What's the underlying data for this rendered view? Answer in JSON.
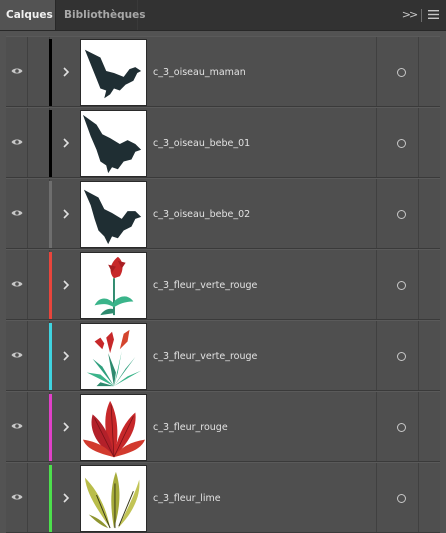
{
  "tabs": {
    "active": "Calques",
    "inactive": "Bibliothèques",
    "collapse_glyph": ">>"
  },
  "layers": [
    {
      "name": "c_3_oiseau_maman",
      "color": "#000000",
      "thumb": "bird-icon"
    },
    {
      "name": "c_3_oiseau_bebe_01",
      "color": "#000000",
      "thumb": "bird-icon"
    },
    {
      "name": "c_3_oiseau_bebe_02",
      "color": "#6e6e6e",
      "thumb": "bird-icon"
    },
    {
      "name": "c_3_fleur_verte_rouge",
      "color": "#e8453c",
      "thumb": "red-flower-icon"
    },
    {
      "name": "c_3_fleur_verte_rouge",
      "color": "#3fd4e0",
      "thumb": "green-red-plant-icon"
    },
    {
      "name": "c_3_fleur_rouge",
      "color": "#e040c8",
      "thumb": "red-plant-icon"
    },
    {
      "name": "c_3_fleur_lime",
      "color": "#4ce04c",
      "thumb": "lime-plant-icon"
    }
  ]
}
